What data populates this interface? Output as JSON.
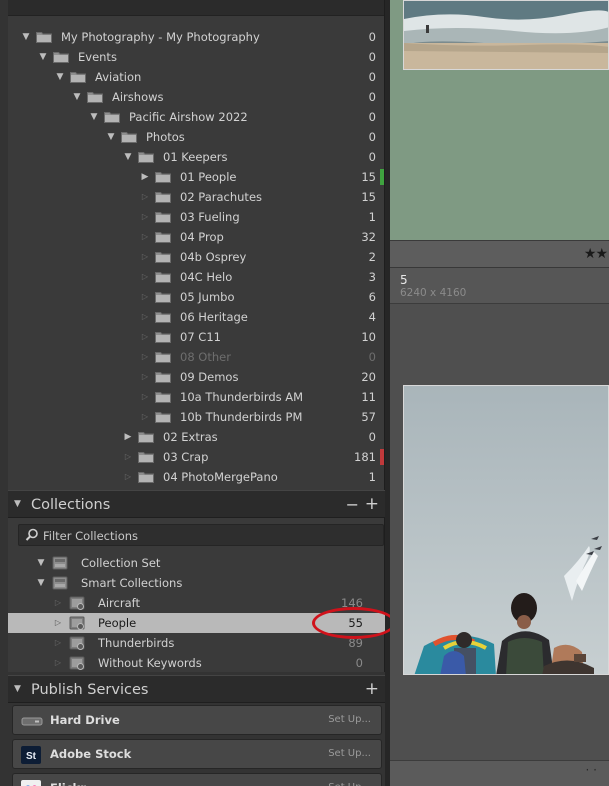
{
  "folders": [
    {
      "name": "My Photography - My Photography",
      "count": "0",
      "depth": 0,
      "toggle": "open"
    },
    {
      "name": "Events",
      "count": "0",
      "depth": 1,
      "toggle": "open"
    },
    {
      "name": "Aviation",
      "count": "0",
      "depth": 2,
      "toggle": "open"
    },
    {
      "name": "Airshows",
      "count": "0",
      "depth": 3,
      "toggle": "open"
    },
    {
      "name": "Pacific Airshow 2022",
      "count": "0",
      "depth": 4,
      "toggle": "open"
    },
    {
      "name": "Photos",
      "count": "0",
      "depth": 5,
      "toggle": "open"
    },
    {
      "name": "01 Keepers",
      "count": "0",
      "depth": 6,
      "toggle": "open"
    },
    {
      "name": "01 People",
      "count": "15",
      "depth": 7,
      "toggle": "closed",
      "flag": "#3fa33f"
    },
    {
      "name": "02 Parachutes",
      "count": "15",
      "depth": 7,
      "toggle": "empty"
    },
    {
      "name": "03 Fueling",
      "count": "1",
      "depth": 7,
      "toggle": "empty"
    },
    {
      "name": "04 Prop",
      "count": "32",
      "depth": 7,
      "toggle": "empty"
    },
    {
      "name": "04b Osprey",
      "count": "2",
      "depth": 7,
      "toggle": "empty"
    },
    {
      "name": "04C Helo",
      "count": "3",
      "depth": 7,
      "toggle": "empty"
    },
    {
      "name": "05 Jumbo",
      "count": "6",
      "depth": 7,
      "toggle": "empty"
    },
    {
      "name": "06 Heritage",
      "count": "4",
      "depth": 7,
      "toggle": "empty"
    },
    {
      "name": "07 C11",
      "count": "10",
      "depth": 7,
      "toggle": "empty"
    },
    {
      "name": "08 Other",
      "count": "0",
      "depth": 7,
      "toggle": "empty",
      "dim": true
    },
    {
      "name": "09 Demos",
      "count": "20",
      "depth": 7,
      "toggle": "empty"
    },
    {
      "name": "10a Thunderbirds AM",
      "count": "11",
      "depth": 7,
      "toggle": "empty"
    },
    {
      "name": "10b  Thunderbirds PM",
      "count": "57",
      "depth": 7,
      "toggle": "empty"
    },
    {
      "name": "02 Extras",
      "count": "0",
      "depth": 6,
      "toggle": "closed"
    },
    {
      "name": "03 Crap",
      "count": "181",
      "depth": 6,
      "toggle": "empty",
      "flag": "#c0393b"
    },
    {
      "name": "04 PhotoMergePano",
      "count": "1",
      "depth": 6,
      "toggle": "empty"
    }
  ],
  "collections_header": {
    "title": "Collections",
    "minus": "−",
    "plus": "+"
  },
  "filter": {
    "placeholder": "Filter Collections"
  },
  "collections": [
    {
      "name": "Collection Set",
      "count": "",
      "kind": "set",
      "depth": 0,
      "toggle": "open"
    },
    {
      "name": "Smart Collections",
      "count": "",
      "kind": "set",
      "depth": 0,
      "toggle": "open"
    },
    {
      "name": "Aircraft",
      "count": "146",
      "kind": "smart",
      "depth": 1,
      "toggle": "empty"
    },
    {
      "name": "People",
      "count": "55",
      "kind": "smart",
      "depth": 1,
      "toggle": "empty",
      "selected": true
    },
    {
      "name": "Thunderbirds",
      "count": "89",
      "kind": "smart",
      "depth": 1,
      "toggle": "empty"
    },
    {
      "name": "Without Keywords",
      "count": "0",
      "kind": "smart",
      "depth": 1,
      "toggle": "empty"
    }
  ],
  "publish_header": {
    "title": "Publish Services",
    "plus": "+"
  },
  "publish": [
    {
      "name": "Hard Drive",
      "setup": "Set Up...",
      "icon": "hard-drive-icon"
    },
    {
      "name": "Adobe Stock",
      "setup": "Set Up...",
      "icon": "adobe-stock-icon",
      "badge": "St"
    },
    {
      "name": "Flickr",
      "setup": "Set Up...",
      "icon": "flickr-icon"
    }
  ],
  "grid": {
    "stars": "★★",
    "index": "5",
    "dimensions": "6240 x 4160",
    "dots": "· ·"
  },
  "colors": {
    "accent_green": "#3fa33f",
    "accent_red": "#c0393b",
    "annotation_red": "#d0121b",
    "selected_row": "#b9b9b9"
  }
}
